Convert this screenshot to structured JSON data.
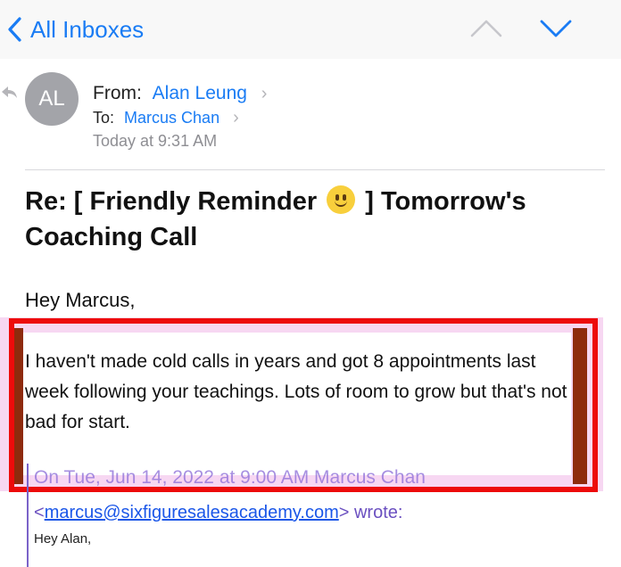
{
  "nav": {
    "back_label": "All Inboxes",
    "colors": {
      "accent": "#1a7cf4",
      "disabled": "#c7c7cc"
    }
  },
  "header": {
    "avatar_initials": "AL",
    "from_label": "From:",
    "from_name": "Alan Leung",
    "to_label": "To:",
    "to_name": "Marcus Chan",
    "timestamp": "Today at 9:31 AM"
  },
  "message": {
    "subject_prefix": "Re: [ Friendly Reminder",
    "subject_emoji": "slightly-smiling-face-icon",
    "subject_suffix": "] Tomorrow's Coaching Call",
    "greeting": "Hey Marcus,",
    "body": "I haven't made cold calls in years and got 8 appointments last week following your teachings. Lots of room to grow but that's not bad for start."
  },
  "quoted": {
    "header_partial": "On Tue, Jun 14, 2022 at 9:00 AM Marcus Chan",
    "email_open": "<",
    "email": "marcus@sixfiguresalesacademy.com",
    "email_close": ">",
    "wrote": " wrote:",
    "greeting": "Hey Alan,"
  },
  "annotation": {
    "highlight_color": "#ed0b0b",
    "frame_color": "#8e2b0d",
    "background_color": "#f7d7f2"
  }
}
